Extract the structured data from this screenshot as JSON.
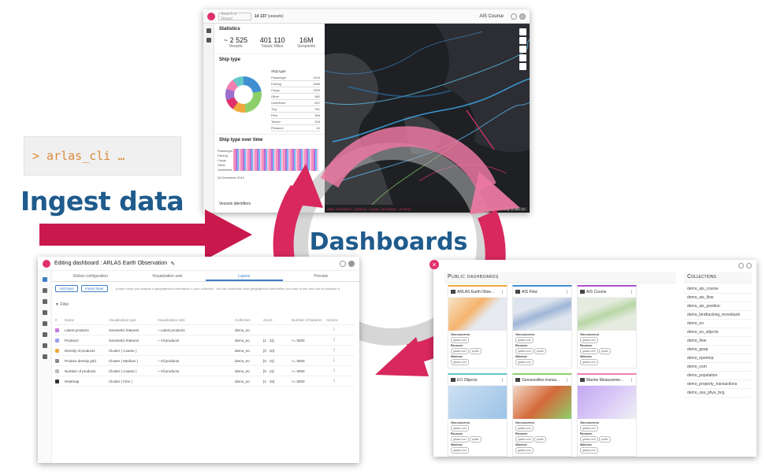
{
  "cli": {
    "command": "> arlas_cli …"
  },
  "labels": {
    "ingest": "Ingest data",
    "dashboards": "Dashboards"
  },
  "top_screenshot": {
    "search_placeholder": "Search a Vessel",
    "count": "14 137",
    "count_suffix": "(vessels)",
    "title": "AIS Course",
    "stats_title": "Statistics",
    "stats": [
      {
        "value": "~ 2 525",
        "label": "Vessels"
      },
      {
        "value": "401 110",
        "label": "Nautic Miles"
      },
      {
        "value": "16M",
        "label": "Geopoints"
      }
    ],
    "ship_type_title": "Ship type",
    "ship_type_legend_title": "Ship type",
    "ship_types": [
      {
        "name": "Passenger",
        "count": "1516"
      },
      {
        "name": "Fishing",
        "count": "1966"
      },
      {
        "name": "Cargo",
        "count": "1300"
      },
      {
        "name": "Other",
        "count": "982"
      },
      {
        "name": "Undefined",
        "count": "621"
      },
      {
        "name": "Tug",
        "count": "391"
      },
      {
        "name": "Pilot",
        "count": "359"
      },
      {
        "name": "Tanker",
        "count": "318"
      },
      {
        "name": "Pleasure",
        "count": "64"
      }
    ],
    "ship_type_over_time_title": "Ship type over time",
    "heat_labels": [
      "Passenger",
      "Fishing",
      "Cargo",
      "Other",
      "Undefined"
    ],
    "heat_date": "26 December 2019",
    "vessel_id_title": "Vessels identifiers",
    "map_bottom_left": "Start: 22/12/2019 · 23:59:00 · Cursor: 24/12/2019 · 12:00:00",
    "map_coords": "Lat: 55.844 79 · Lng: 10.852 20"
  },
  "edit_screenshot": {
    "title": "Editing dashboard : ARLAS Earth Observation",
    "tabs": [
      "Global configuration",
      "Visualization sets",
      "Layers",
      "Preview"
    ],
    "selected_tab": "Layers",
    "add_layer": "Add layer",
    "import_layer": "Import layer",
    "hint": "A layer helps you analyse a geographical information in your collection. You can customise what geographical information you want to see and how to visualise it.",
    "filter": "Filter",
    "columns": [
      "#",
      "Name",
      "Visualisation type",
      "Visualisation sets",
      "Collection",
      "Zoom",
      "Number of features",
      "Actions"
    ],
    "rows": [
      {
        "name": "Latest products",
        "type": "Geometric features",
        "sets": "~ Latest products",
        "collection": "demo_eo",
        "zoom": "",
        "features": ""
      },
      {
        "name": "Products",
        "type": "Geometric features",
        "sets": "~ All products",
        "collection": "demo_eo",
        "zoom": "[1 · 11]",
        "features": "<= 5000"
      },
      {
        "name": "Density of products",
        "type": "Cluster ( Coarse )",
        "sets": "",
        "collection": "demo_eo",
        "zoom": "[0 · 10]",
        "features": ""
      },
      {
        "name": "Product density grid",
        "type": "Cluster ( Medium )",
        "sets": "~ All products",
        "collection": "demo_eo",
        "zoom": "[0 · 11]",
        "features": ">= 5000"
      },
      {
        "name": "Number of products",
        "type": "Cluster ( Coarse )",
        "sets": "~ All products",
        "collection": "demo_eo",
        "zoom": "[0 · 11]",
        "features": ">= 5000"
      },
      {
        "name": "Heatmap",
        "type": "Cluster ( Fine )",
        "sets": "",
        "collection": "demo_eo",
        "zoom": "[1 · 15]",
        "features": ">= 5000"
      }
    ]
  },
  "pub_screenshot": {
    "title": "Public dashboards",
    "collections_title": "Collections",
    "collections": [
      "demo_ais_course",
      "demo_ais_flow",
      "demo_ais_position",
      "demo_birdtracking_movebank",
      "demo_eo",
      "demo_eo_objects",
      "demo_flow",
      "demo_geep",
      "demo_opentop",
      "demo_osm",
      "demo_population",
      "demo_property_transactions",
      "demo_ssa_phys_bcg"
    ],
    "cards": [
      {
        "name": "ARLAS Earth Obse...",
        "accent": "#f0a83c"
      },
      {
        "name": "AIS Flow",
        "accent": "#3f8fd2"
      },
      {
        "name": "AIS Course",
        "accent": "#b04fd0"
      },
      {
        "name": "EO Objects",
        "accent": "#66c8c8"
      },
      {
        "name": "Geoseuvilles transa...",
        "accent": "#8ccf6a"
      },
      {
        "name": "Marine Measureme...",
        "accent": "#f27fb2"
      }
    ],
    "organisation_label": "Organisation",
    "readers_label": "Readers",
    "writers_label": "Writers",
    "org_chip": "gisaia.com",
    "reader_chips": [
      "gisaia.com",
      "public"
    ],
    "writer_chip": "gisaia.com"
  },
  "colors": {
    "brand_pink": "#e0306c",
    "brand_blue": "#1f5b8c",
    "cli_text": "#d98a3a"
  }
}
